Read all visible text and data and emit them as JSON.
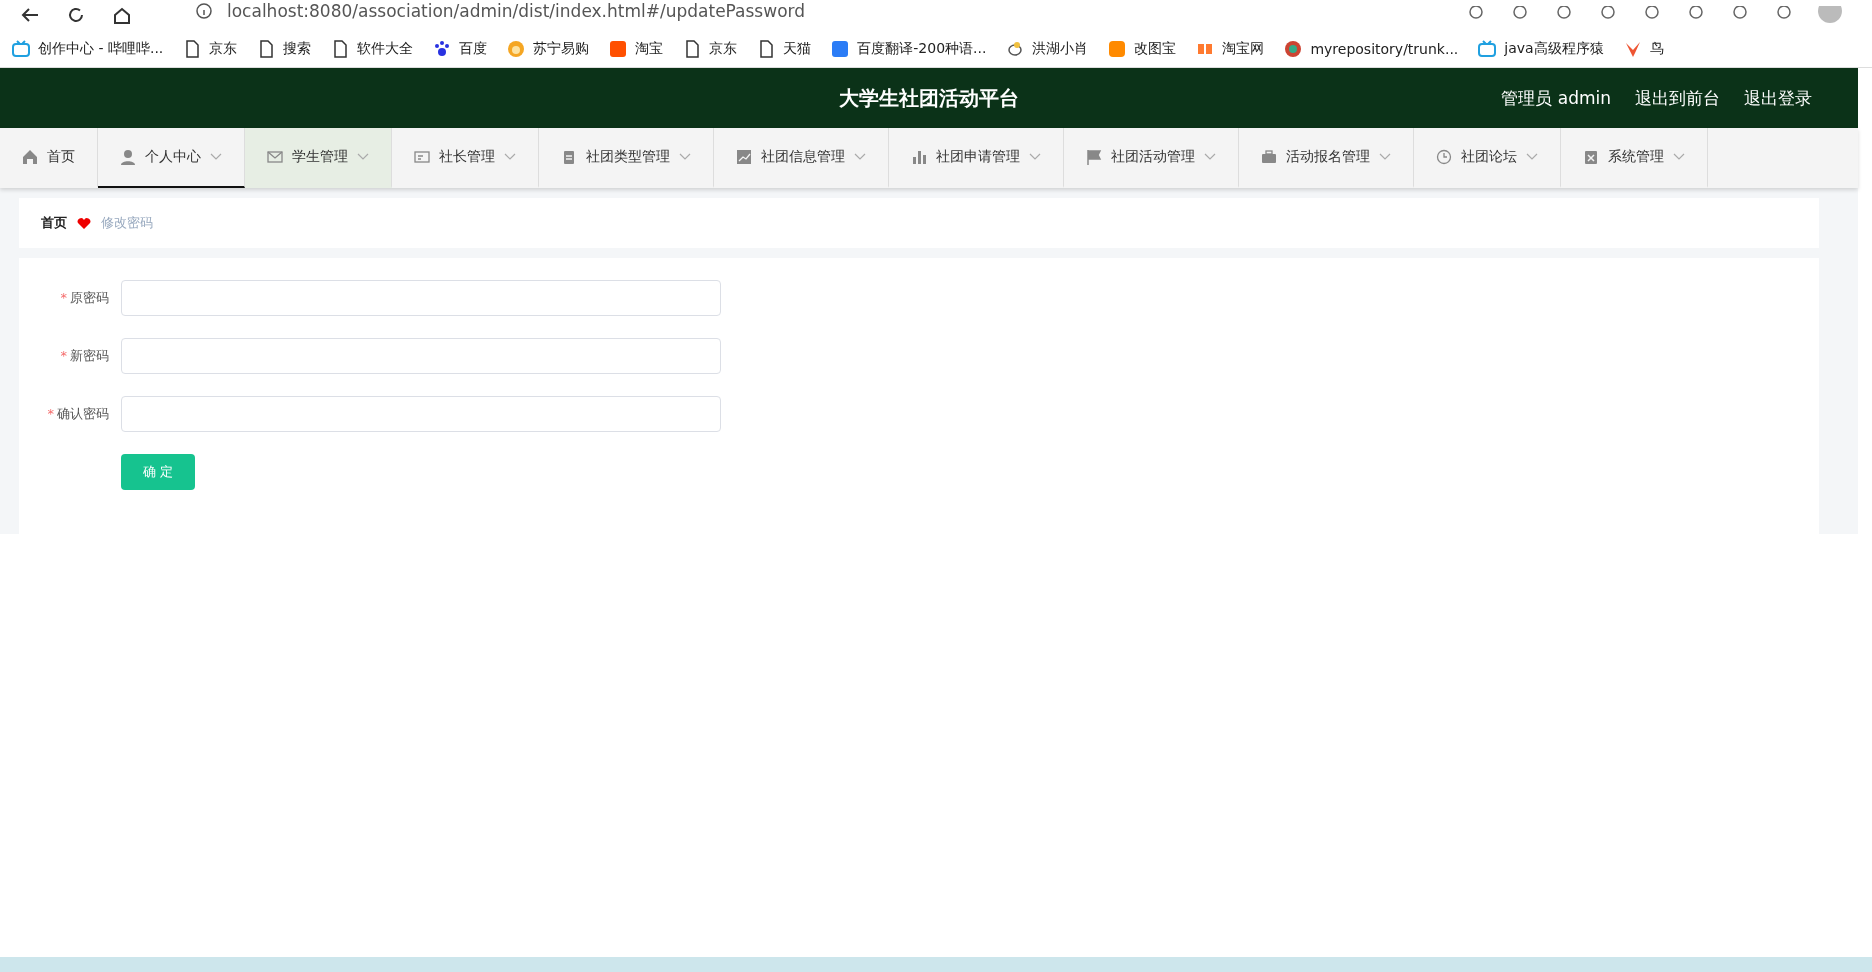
{
  "browser": {
    "address": "localhost:8080/association/admin/dist/index.html#/updatePassword",
    "bookmarks": [
      {
        "label": "创作中心 - 哔哩哔..."
      },
      {
        "label": "京东"
      },
      {
        "label": "搜索"
      },
      {
        "label": "软件大全"
      },
      {
        "label": "百度"
      },
      {
        "label": "苏宁易购"
      },
      {
        "label": "淘宝"
      },
      {
        "label": "京东"
      },
      {
        "label": "天猫"
      },
      {
        "label": "百度翻译-200种语..."
      },
      {
        "label": "洪湖小肖"
      },
      {
        "label": "改图宝"
      },
      {
        "label": "淘宝网"
      },
      {
        "label": "myrepository/trunk..."
      },
      {
        "label": "java高级程序猿"
      },
      {
        "label": "鸟"
      }
    ]
  },
  "header": {
    "title": "大学生社团活动平台",
    "user": "管理员 admin",
    "links": [
      "退出到前台",
      "退出登录"
    ]
  },
  "nav": [
    {
      "label": "首页",
      "selected": false,
      "hovered": false,
      "dropdown": false
    },
    {
      "label": "个人中心",
      "selected": true,
      "hovered": false,
      "dropdown": true
    },
    {
      "label": "学生管理",
      "selected": false,
      "hovered": true,
      "dropdown": true
    },
    {
      "label": "社长管理",
      "selected": false,
      "hovered": false,
      "dropdown": true
    },
    {
      "label": "社团类型管理",
      "selected": false,
      "hovered": false,
      "dropdown": true
    },
    {
      "label": "社团信息管理",
      "selected": false,
      "hovered": false,
      "dropdown": true
    },
    {
      "label": "社团申请管理",
      "selected": false,
      "hovered": false,
      "dropdown": true
    },
    {
      "label": "社团活动管理",
      "selected": false,
      "hovered": false,
      "dropdown": true
    },
    {
      "label": "活动报名管理",
      "selected": false,
      "hovered": false,
      "dropdown": true
    },
    {
      "label": "社团论坛",
      "selected": false,
      "hovered": false,
      "dropdown": true
    },
    {
      "label": "系统管理",
      "selected": false,
      "hovered": false,
      "dropdown": true
    }
  ],
  "breadcrumb": [
    {
      "label": "首页",
      "current": false
    },
    {
      "label": "修改密码",
      "current": true
    }
  ],
  "form": {
    "fields": [
      {
        "label": "原密码",
        "required_mark": "*"
      },
      {
        "label": "新密码",
        "required_mark": "*"
      },
      {
        "label": "确认密码",
        "required_mark": "*"
      }
    ],
    "submit": "确 定"
  }
}
